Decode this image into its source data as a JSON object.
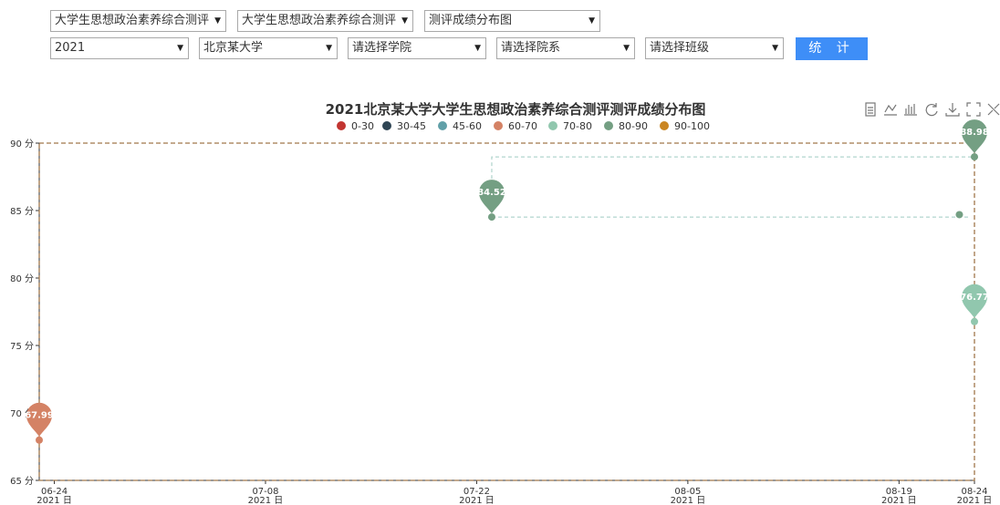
{
  "filters": {
    "row1": [
      {
        "value": "大学生思想政治素养综合测评"
      },
      {
        "value": "大学生思想政治素养综合测评"
      },
      {
        "value": "测评成绩分布图"
      }
    ],
    "row2": [
      {
        "value": "2021"
      },
      {
        "value": "北京某大学"
      },
      {
        "value": "请选择学院"
      },
      {
        "value": "请选择院系"
      },
      {
        "value": "请选择班级"
      }
    ],
    "submit_label": "统 计",
    "arrow": "▼"
  },
  "toolbox": [
    "data-view-icon",
    "line-icon",
    "bar-icon",
    "restore-icon",
    "download-icon",
    "zoom-icon",
    "brush-icon"
  ],
  "chart_data": {
    "type": "scatter",
    "title": "2021北京某大学大学生思想政治素养综合测评测评成绩分布图",
    "legend": [
      {
        "name": "0-30",
        "color": "#c23531"
      },
      {
        "name": "30-45",
        "color": "#2f4554"
      },
      {
        "name": "45-60",
        "color": "#61a0a8"
      },
      {
        "name": "60-70",
        "color": "#d48265"
      },
      {
        "name": "70-80",
        "color": "#91c7ae"
      },
      {
        "name": "80-90",
        "color": "#749f83"
      },
      {
        "name": "90-100",
        "color": "#ca8622"
      }
    ],
    "y_axis": {
      "min": 65,
      "max": 90,
      "ticks": [
        65,
        70,
        75,
        80,
        85,
        90
      ],
      "unit": "分"
    },
    "x_axis": {
      "min": "2021-06-23",
      "max": "2021-08-24",
      "ticks": [
        {
          "date": "2021-06-24",
          "label": "06-24",
          "sub": "2021 日"
        },
        {
          "date": "2021-07-08",
          "label": "07-08",
          "sub": "2021 日"
        },
        {
          "date": "2021-07-22",
          "label": "07-22",
          "sub": "2021 日"
        },
        {
          "date": "2021-08-05",
          "label": "08-05",
          "sub": "2021 日"
        },
        {
          "date": "2021-08-19",
          "label": "08-19",
          "sub": "2021 日"
        },
        {
          "date": "2021-08-24",
          "label": "08-24",
          "sub": "2021 日"
        }
      ]
    },
    "points": [
      {
        "date": "2021-06-23",
        "value": 67.99,
        "label": "67.99",
        "color": "#d48265"
      },
      {
        "date": "2021-07-23",
        "value": 84.52,
        "label": "84.52",
        "color": "#749f83"
      },
      {
        "date": "2021-08-24",
        "value": 88.98,
        "label": "88.98",
        "color": "#749f83"
      },
      {
        "date": "2021-08-24",
        "value": 76.77,
        "label": "76.77",
        "color": "#91c7ae"
      },
      {
        "date": "2021-08-23",
        "value": 84.7,
        "label": "",
        "color": "#749f83"
      }
    ],
    "mark_lines": [
      {
        "value": 90,
        "color": "#a0774a"
      },
      {
        "value": 88.98,
        "color": "#9fcbc2"
      },
      {
        "value": 84.52,
        "color": "#9fcbc2"
      }
    ]
  }
}
